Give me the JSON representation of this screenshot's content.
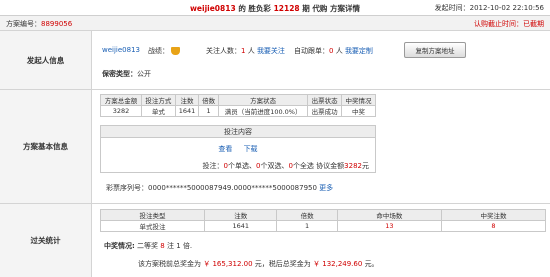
{
  "header": {
    "user": "weijie0813",
    "title_mid": "的 胜负彩",
    "issue": "12128",
    "title_tail": "期 代购 方案详情",
    "time_label": "发起时间：",
    "time_value": "2012-10-02 22:10:56"
  },
  "subheader": {
    "id_label": "方案编号：",
    "id_value": "8899056",
    "deadline": "认购截止时间：已截期"
  },
  "sponsor": {
    "label": "发起人信息",
    "user": "weijie0813",
    "record_label": "战绩：",
    "trophy_icon": "trophy-icon",
    "followers_label": "关注人数：",
    "followers_count": "1",
    "followers_unit": "人",
    "follow_link": "我要关注",
    "auto_label": "自动跟单：",
    "auto_count": "0",
    "auto_unit": "人",
    "custom_link": "我要定制",
    "copy_button": "复制方案地址",
    "privacy_label": "保密类型：",
    "privacy_value": "公开"
  },
  "basic": {
    "label": "方案基本信息",
    "columns": [
      "方案总金额",
      "投注方式",
      "注数",
      "倍数",
      "方案状态",
      "出票状态",
      "中奖情况"
    ],
    "row": [
      "3282",
      "单式",
      "1641",
      "1",
      "满员（当前进度100.0%）",
      "出票成功",
      "中奖"
    ],
    "content_title": "投注内容",
    "view_link": "查看",
    "download_link": "下载",
    "summary_prefix": "投注：",
    "single": "0",
    "single_label": "个单选、",
    "double": "0",
    "double_label": "个双选、",
    "full": "0",
    "full_label": "个全选 协议金额",
    "amount": "3282",
    "amount_unit": "元",
    "serial_label": "彩票序列号：",
    "serial_value": "0000******5000087949.0000******5000087950",
    "more_link": "更多"
  },
  "result": {
    "label": "过关统计",
    "columns": [
      "投注类型",
      "注数",
      "倍数",
      "命中场数",
      "中奖注数"
    ],
    "row": [
      "单式投注",
      "1641",
      "1",
      "13",
      "8"
    ],
    "prize_label": "中奖情况:",
    "prize_text": "二等奖",
    "prize_count": "8",
    "prize_tail": "注 1 倍.",
    "line_prefix": "该方案税前总奖金为",
    "pre_tax": "￥ 165,312.00",
    "line_mid": "元，税后总奖金为",
    "after_tax": "￥ 132,249.60",
    "line_end": "元。"
  }
}
